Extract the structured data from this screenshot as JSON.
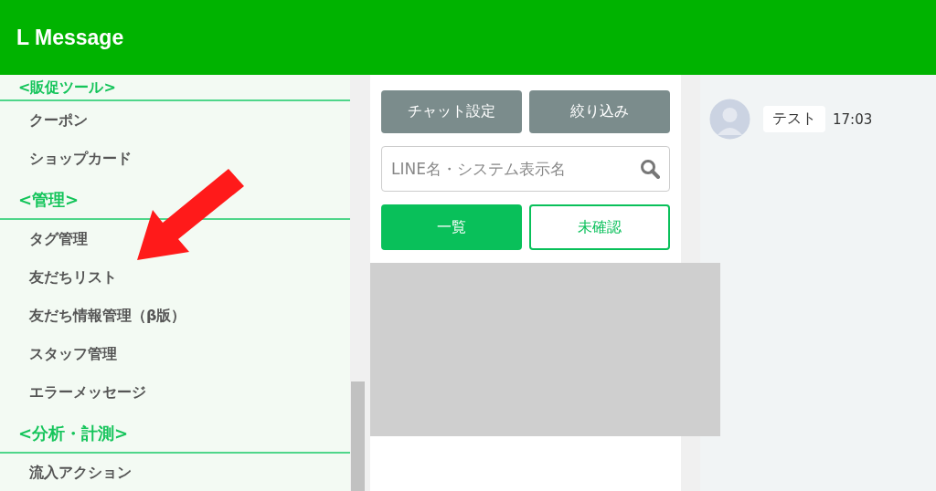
{
  "header": {
    "title": "L Message"
  },
  "sidebar": {
    "sections": [
      {
        "title": "<販促ツール>",
        "items": [
          {
            "label": "クーポン"
          },
          {
            "label": "ショップカード"
          }
        ]
      },
      {
        "title": "<管理>",
        "items": [
          {
            "label": "タグ管理"
          },
          {
            "label": "友だちリスト"
          },
          {
            "label": "友だち情報管理（β版）"
          },
          {
            "label": "スタッフ管理"
          },
          {
            "label": "エラーメッセージ"
          }
        ]
      },
      {
        "title": "<分析・計測>",
        "items": [
          {
            "label": "流入アクション"
          }
        ]
      }
    ]
  },
  "chat_panel": {
    "buttons": [
      "チャット設定",
      "絞り込み"
    ],
    "search": {
      "placeholder": "LINE名・システム表示名"
    },
    "filters": [
      {
        "label": "一覧",
        "selected": true
      },
      {
        "label": "未確認",
        "selected": false
      }
    ]
  },
  "chat_list": [
    {
      "name": "テスト",
      "time": "17:03"
    }
  ]
}
